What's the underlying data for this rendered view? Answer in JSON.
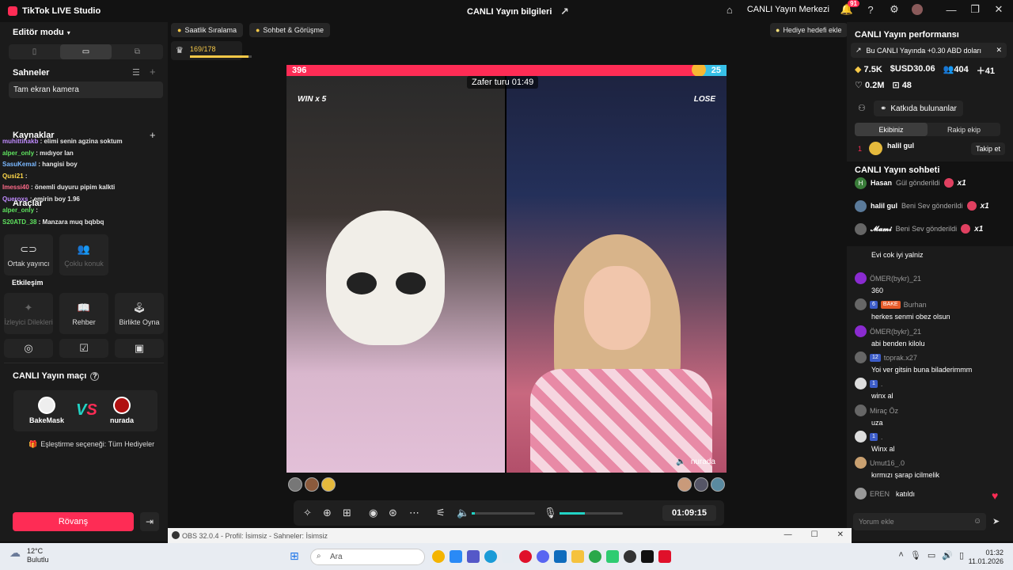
{
  "titlebar": {
    "app_name": "TikTok LIVE Studio",
    "center_title": "CANLI Yayın bilgileri",
    "live_center": "CANLI Yayın Merkezi",
    "notif_count": "91"
  },
  "left": {
    "editor_mode": "Editör modu",
    "scenes_title": "Sahneler",
    "scene_item": "Tam ekran kamera",
    "sources_title": "Kaynaklar",
    "tools_title": "Araçlar",
    "chat_overlay": [
      {
        "user": "muhittinakb",
        "msg": ": elimi senin agzina soktum"
      },
      {
        "user": "alper_only",
        "msg": ": mıdıyor lan"
      },
      {
        "user": "SasuKemal",
        "msg": ": hangisi boy"
      },
      {
        "user": "Qusi21",
        "msg": ":"
      },
      {
        "user": "Imessi40",
        "msg": ": önemli duyuru pipim kalkti"
      },
      {
        "user": "Queroxs",
        "msg": ": emirin boy 1.96"
      },
      {
        "user": "alper_only",
        "msg": ":"
      },
      {
        "user": "S20ATD_38",
        "msg": ": Manzara muq bqbbq"
      }
    ],
    "tools": {
      "cohost": "Ortak yayıncı",
      "multi_guest": "Çoklu konuk",
      "interaction_title": "Etkileşim",
      "viewer_wishes": "İzleyici Dilekleri",
      "guide": "Rehber",
      "play_together": "Birlikte Oyna"
    },
    "match": {
      "title": "CANLI Yayın maçı",
      "player1": "BakeMask",
      "player2": "nurada",
      "pairing": "Eşleştirme seçeneği: Tüm Hediyeler",
      "rematch": "Rövanş"
    }
  },
  "top": {
    "hourly_ranking": "Saatlik Sıralama",
    "chat_meet": "Sohbet & Görüşme",
    "add_gift_goal": "Hediye hedefi ekle",
    "progress_text": "169/178",
    "progress_fraction": 0.95
  },
  "stage": {
    "score_left": "396",
    "score_right": "25",
    "score_share_left": 0.94,
    "win_label": "WIN",
    "win_count": "x 5",
    "lose_label": "LOSE",
    "victory_round": "Zafer turu 01:49",
    "right_name": "nurada"
  },
  "controls": {
    "elapsed": "01:09:15",
    "volume_level": 0.05,
    "mic_level": 0.4
  },
  "right": {
    "perf_title": "CANLI Yayın performansı",
    "perf_banner": "Bu CANLI Yayında +0.30 ABD doları",
    "stats": {
      "diamonds": "7.5K",
      "usd": "USD30.06",
      "viewers": "404",
      "new_followers": "41",
      "likes": "0.2M",
      "gifters": "48"
    },
    "contributors": "Katkıda bulunanlar",
    "tab_ours": "Ekibiniz",
    "tab_rival": "Rakip ekip",
    "rank1_num": "1",
    "rank1_name": "halil gul",
    "follow": "Takip et",
    "chat_title": "CANLI Yayın sohbeti",
    "gifts": [
      {
        "avatar": "H",
        "user": "Hasan",
        "action": "Gül gönderildi",
        "count": "x1"
      },
      {
        "avatar": "",
        "user": "halil gul",
        "action": "Beni Sev gönderildi",
        "count": "x1"
      },
      {
        "avatar": "",
        "user": "𝓜𝓪𝓶𝓲",
        "action": "Beni Sev gönderildi",
        "count": "x1"
      }
    ],
    "comments": [
      {
        "user": "",
        "badge": "",
        "text": "Evi cok iyi yalniz"
      },
      {
        "user": "ÖMER(bykr)_21",
        "badge": "",
        "text": "360"
      },
      {
        "user": "Burhan",
        "badge": "6",
        "bake": "BAKE",
        "text": "herkes senmi obez olsun"
      },
      {
        "user": "ÖMER(bykr)_21",
        "badge": "",
        "text": "abi benden kilolu"
      },
      {
        "user": "toprak.x27",
        "badge": "12",
        "text": "Yoi ver gitsin buna biladerimmm"
      },
      {
        "user": ".",
        "badge": "1",
        "text": "winx al"
      },
      {
        "user": "Miraç Öz",
        "badge": "",
        "text": "uza"
      },
      {
        "user": ".",
        "badge": "1",
        "text": "Winx al"
      },
      {
        "user": "Umut16_.0",
        "badge": "",
        "text": "kırmızı şarap icilmelik"
      },
      {
        "user": "EREN",
        "badge": "",
        "text": "katıldı"
      }
    ],
    "comment_placeholder": "Yorum ekle"
  },
  "obs": {
    "title": "OBS 32.0.4 - Profil: İsimsiz - Sahneler: İsimsiz"
  },
  "taskbar": {
    "temp": "12°C",
    "weather": "Bulutlu",
    "search": "Ara",
    "time": "01:32",
    "date": "11.01.2026"
  }
}
